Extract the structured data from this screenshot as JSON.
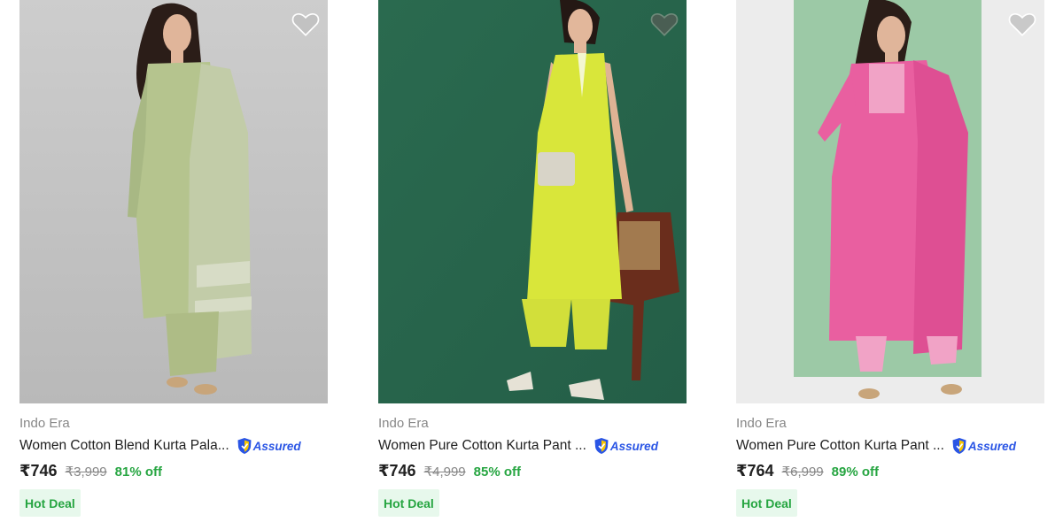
{
  "products": [
    {
      "brand": "Indo Era",
      "title": "Women Cotton Blend Kurta Pala...",
      "assured_label": "Assured",
      "price": "₹746",
      "mrp": "₹3,999",
      "discount": "81% off",
      "badge": "Hot Deal",
      "wishlist_icon": "heart-icon",
      "colors": {
        "background": "#c9c9c9",
        "kurta": "#b5c48e",
        "dupatta": "#c2cca8"
      }
    },
    {
      "brand": "Indo Era",
      "title": "Women Pure Cotton Kurta Pant ...",
      "assured_label": "Assured",
      "price": "₹746",
      "mrp": "₹4,999",
      "discount": "85% off",
      "badge": "Hot Deal",
      "wishlist_icon": "heart-icon",
      "colors": {
        "background": "#2e6b52",
        "kurta": "#d9e63a",
        "chair": "#6a2d1c"
      }
    },
    {
      "brand": "Indo Era",
      "title": "Women Pure Cotton Kurta Pant ...",
      "assured_label": "Assured",
      "price": "₹764",
      "mrp": "₹6,999",
      "discount": "89% off",
      "badge": "Hot Deal",
      "wishlist_icon": "heart-icon",
      "colors": {
        "background": "#eeeeee",
        "panel": "#9cc9a6",
        "kurta": "#e95fa0"
      }
    }
  ],
  "theme": {
    "price_color": "#212121",
    "discount_color": "#26a541",
    "muted_color": "#878787",
    "assured_color": "#2a55e5"
  }
}
